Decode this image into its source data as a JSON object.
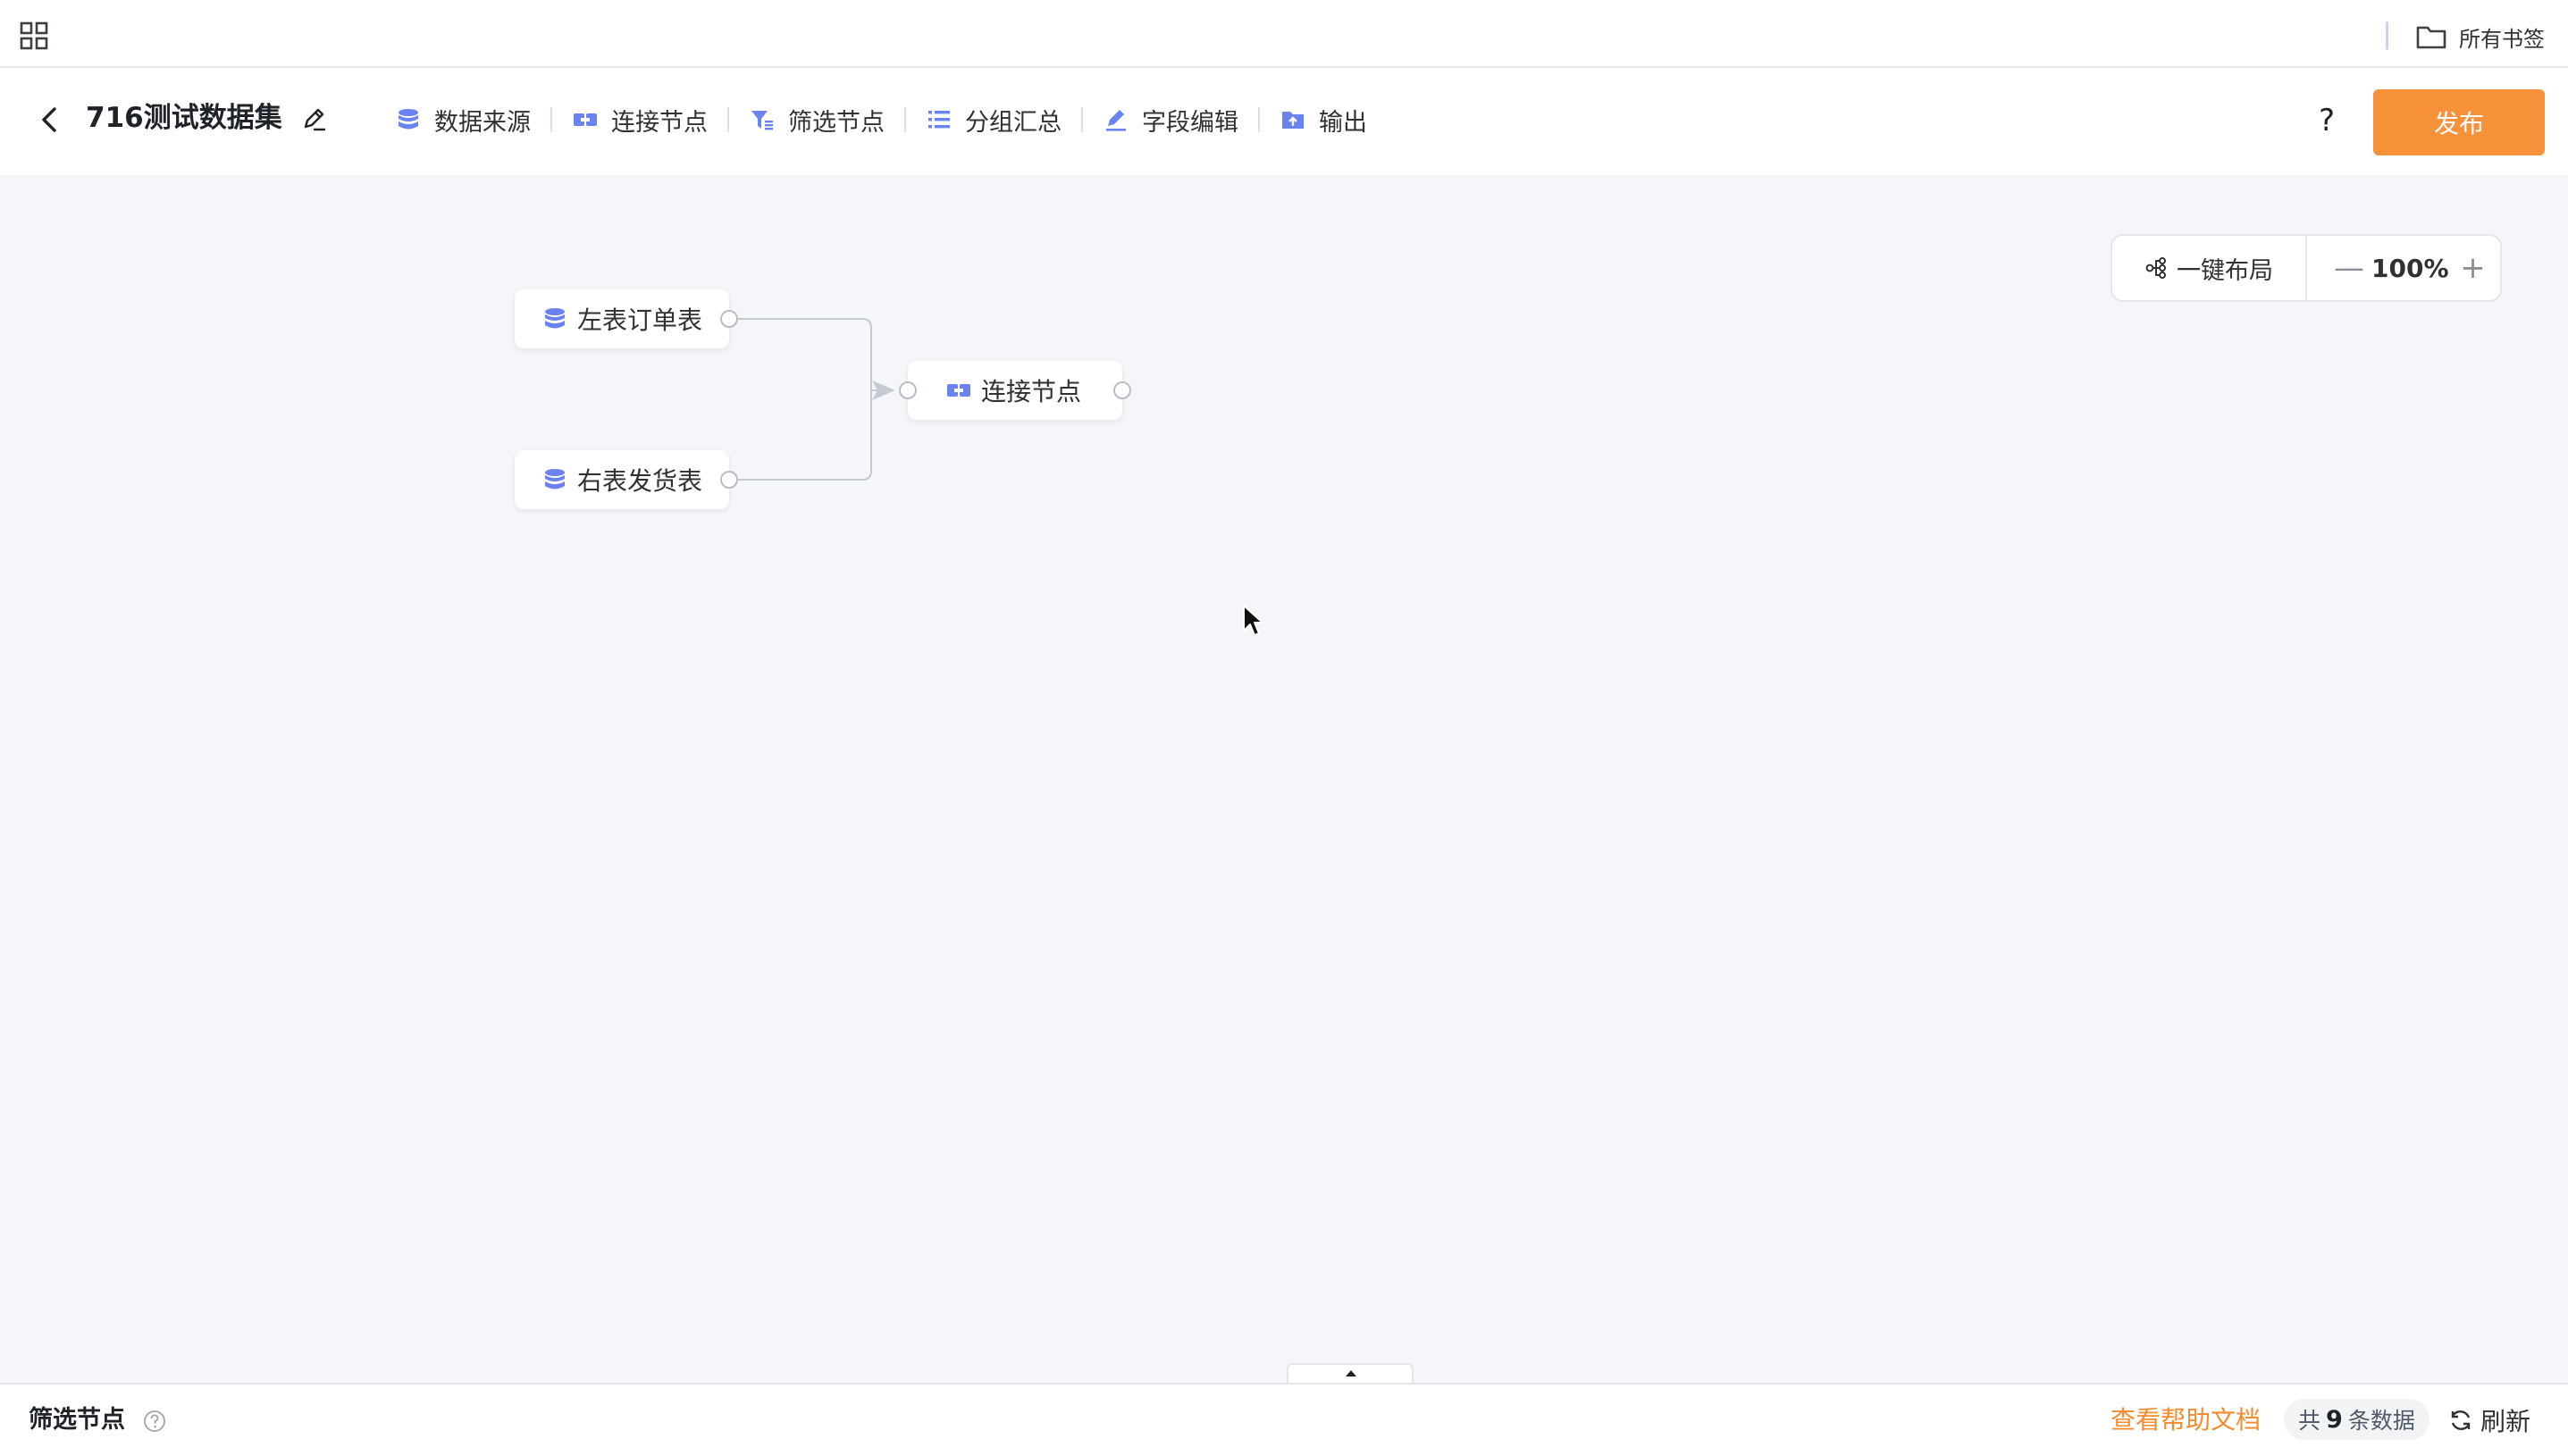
{
  "browser": {
    "bookmark_folder_label": "所有书签"
  },
  "header": {
    "dataset_title": "716测试数据集",
    "toolbar": [
      {
        "label": "数据来源",
        "icon": "database-icon"
      },
      {
        "label": "连接节点",
        "icon": "join-icon"
      },
      {
        "label": "筛选节点",
        "icon": "filter-icon"
      },
      {
        "label": "分组汇总",
        "icon": "group-icon"
      },
      {
        "label": "字段编辑",
        "icon": "pen-icon"
      },
      {
        "label": "输出",
        "icon": "output-folder-icon"
      }
    ],
    "help_label": "?",
    "publish_label": "发布"
  },
  "canvas": {
    "layout_button_label": "一键布局",
    "zoom_level": "100%",
    "zoom_out_label": "—",
    "zoom_in_label": "+",
    "nodes": [
      {
        "label": "左表订单表",
        "type": "datasource"
      },
      {
        "label": "右表发货表",
        "type": "datasource"
      },
      {
        "label": "连接节点",
        "type": "join"
      }
    ]
  },
  "bottom_panel": {
    "title": "筛选节点",
    "help_doc_label": "查看帮助文档",
    "count_prefix": "共",
    "count_value": "9",
    "count_suffix": "条数据",
    "refresh_label": "刷新"
  },
  "colors": {
    "accent": "#f7923b",
    "link": "#f28c2c",
    "node_icon": "#6b83f0",
    "canvas_bg": "#f5f6f9"
  }
}
